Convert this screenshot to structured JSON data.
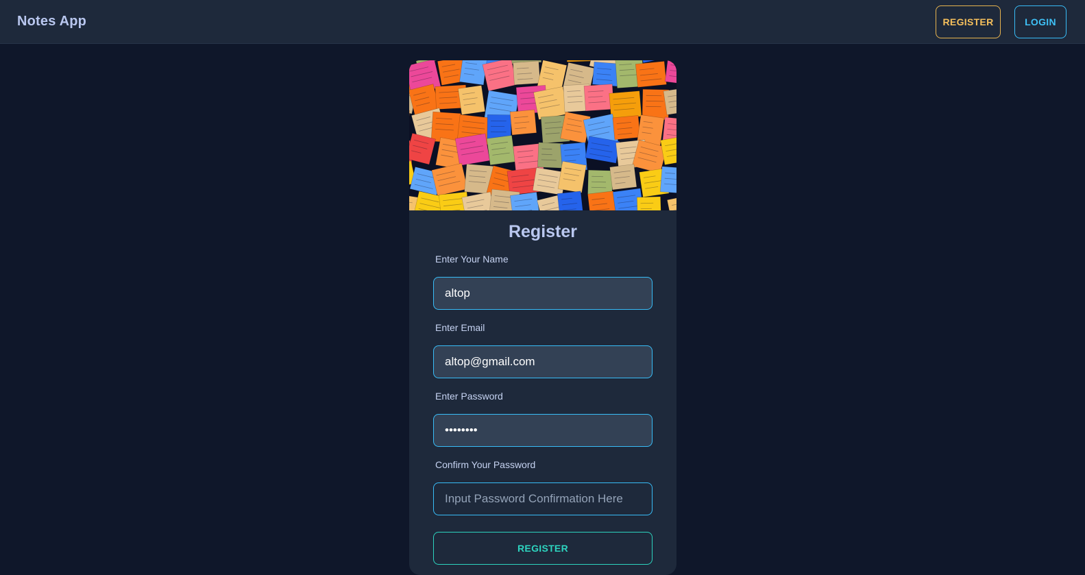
{
  "navbar": {
    "brand": "Notes App",
    "register_label": "REGISTER",
    "login_label": "LOGIN"
  },
  "hero": {
    "image_description": "sticky-notes-wall"
  },
  "form": {
    "title": "Register",
    "fields": [
      {
        "label": "Enter Your Name",
        "value": "altop",
        "type": "text",
        "placeholder": ""
      },
      {
        "label": "Enter Email",
        "value": "altop@gmail.com",
        "type": "email",
        "placeholder": ""
      },
      {
        "label": "Enter Password",
        "value": "12345678",
        "type": "password",
        "placeholder": ""
      },
      {
        "label": "Confirm Your Password",
        "value": "",
        "type": "password",
        "placeholder": "Input Password Confirmation Here"
      }
    ],
    "submit_label": "REGISTER"
  },
  "colors": {
    "background": "#0f172a",
    "surface": "#1e293b",
    "input_filled": "#334155",
    "accent_blue": "#38bdf8",
    "accent_yellow": "#f6c05c",
    "accent_teal": "#2dd4bf",
    "title_text": "#b9c7ef"
  }
}
